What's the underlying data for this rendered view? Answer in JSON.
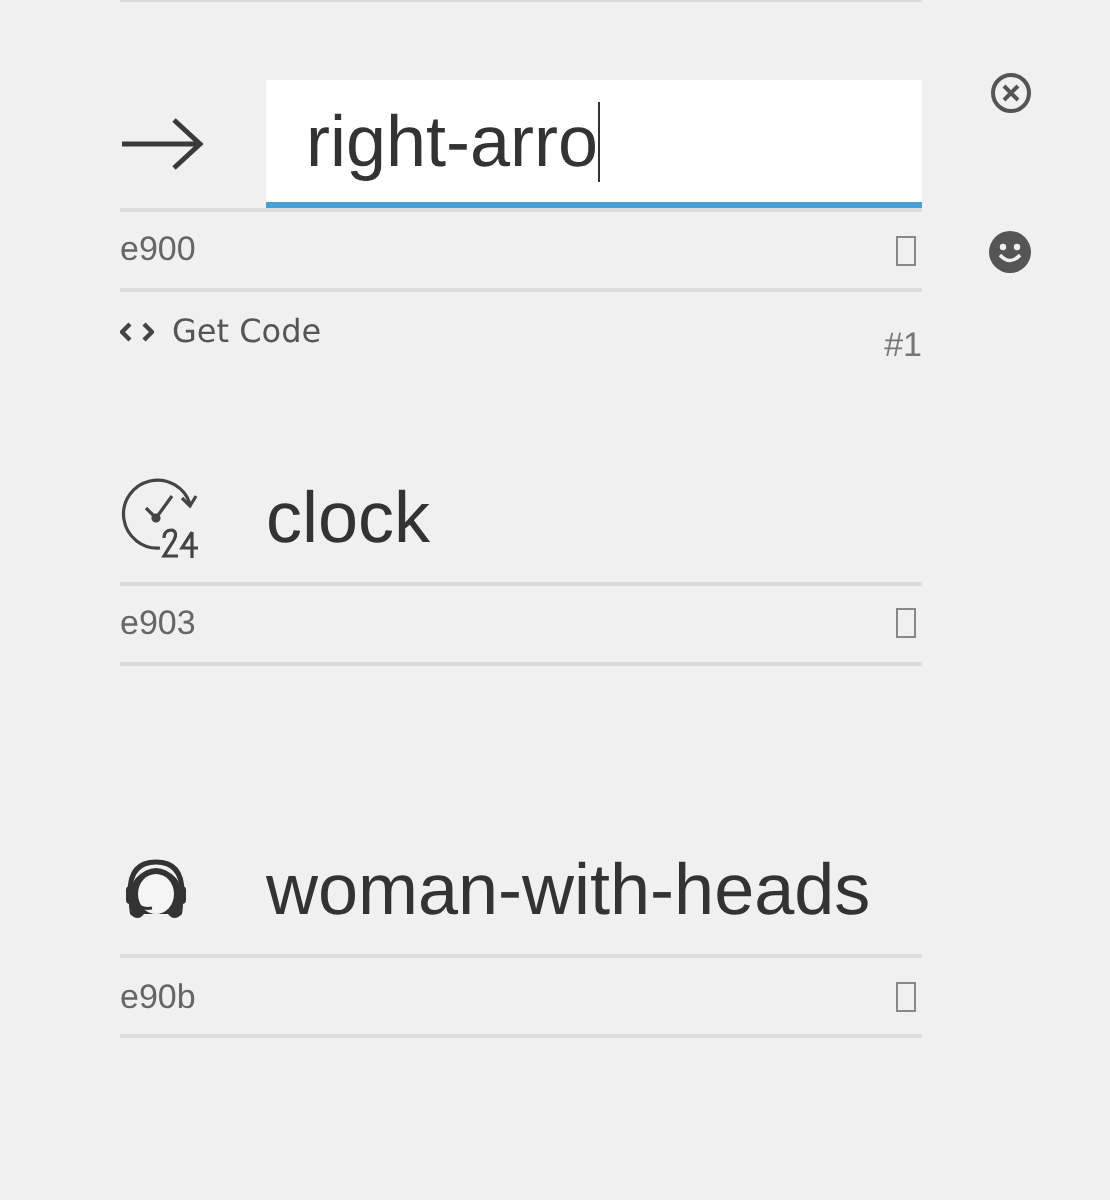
{
  "glyphs": [
    {
      "name": "right-arro",
      "code": "e900",
      "editing": true,
      "get_code": "Get Code",
      "index": "#1",
      "kind": "arrow"
    },
    {
      "name": "clock",
      "code": "e903",
      "editing": false,
      "kind": "clock"
    },
    {
      "name": "woman-with-heads",
      "code": "e90b",
      "editing": false,
      "kind": "headset"
    }
  ]
}
